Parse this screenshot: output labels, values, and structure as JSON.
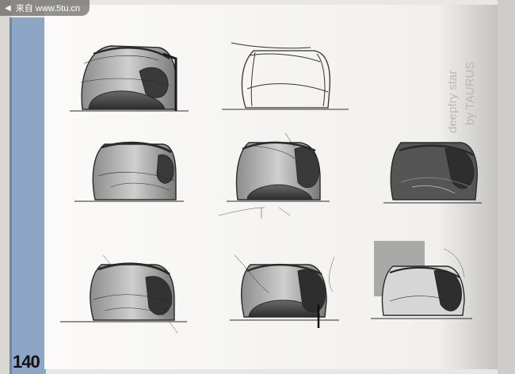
{
  "watermark": {
    "text": "来自 www.5tu.cn"
  },
  "side_title": {
    "line1": "deepfry star",
    "line2": "by TAURUS"
  },
  "page_number": "140",
  "colors": {
    "spine_blue": "#8ea6c6",
    "paper": "#f6f5f2",
    "pencil": "#2a2a2a"
  }
}
